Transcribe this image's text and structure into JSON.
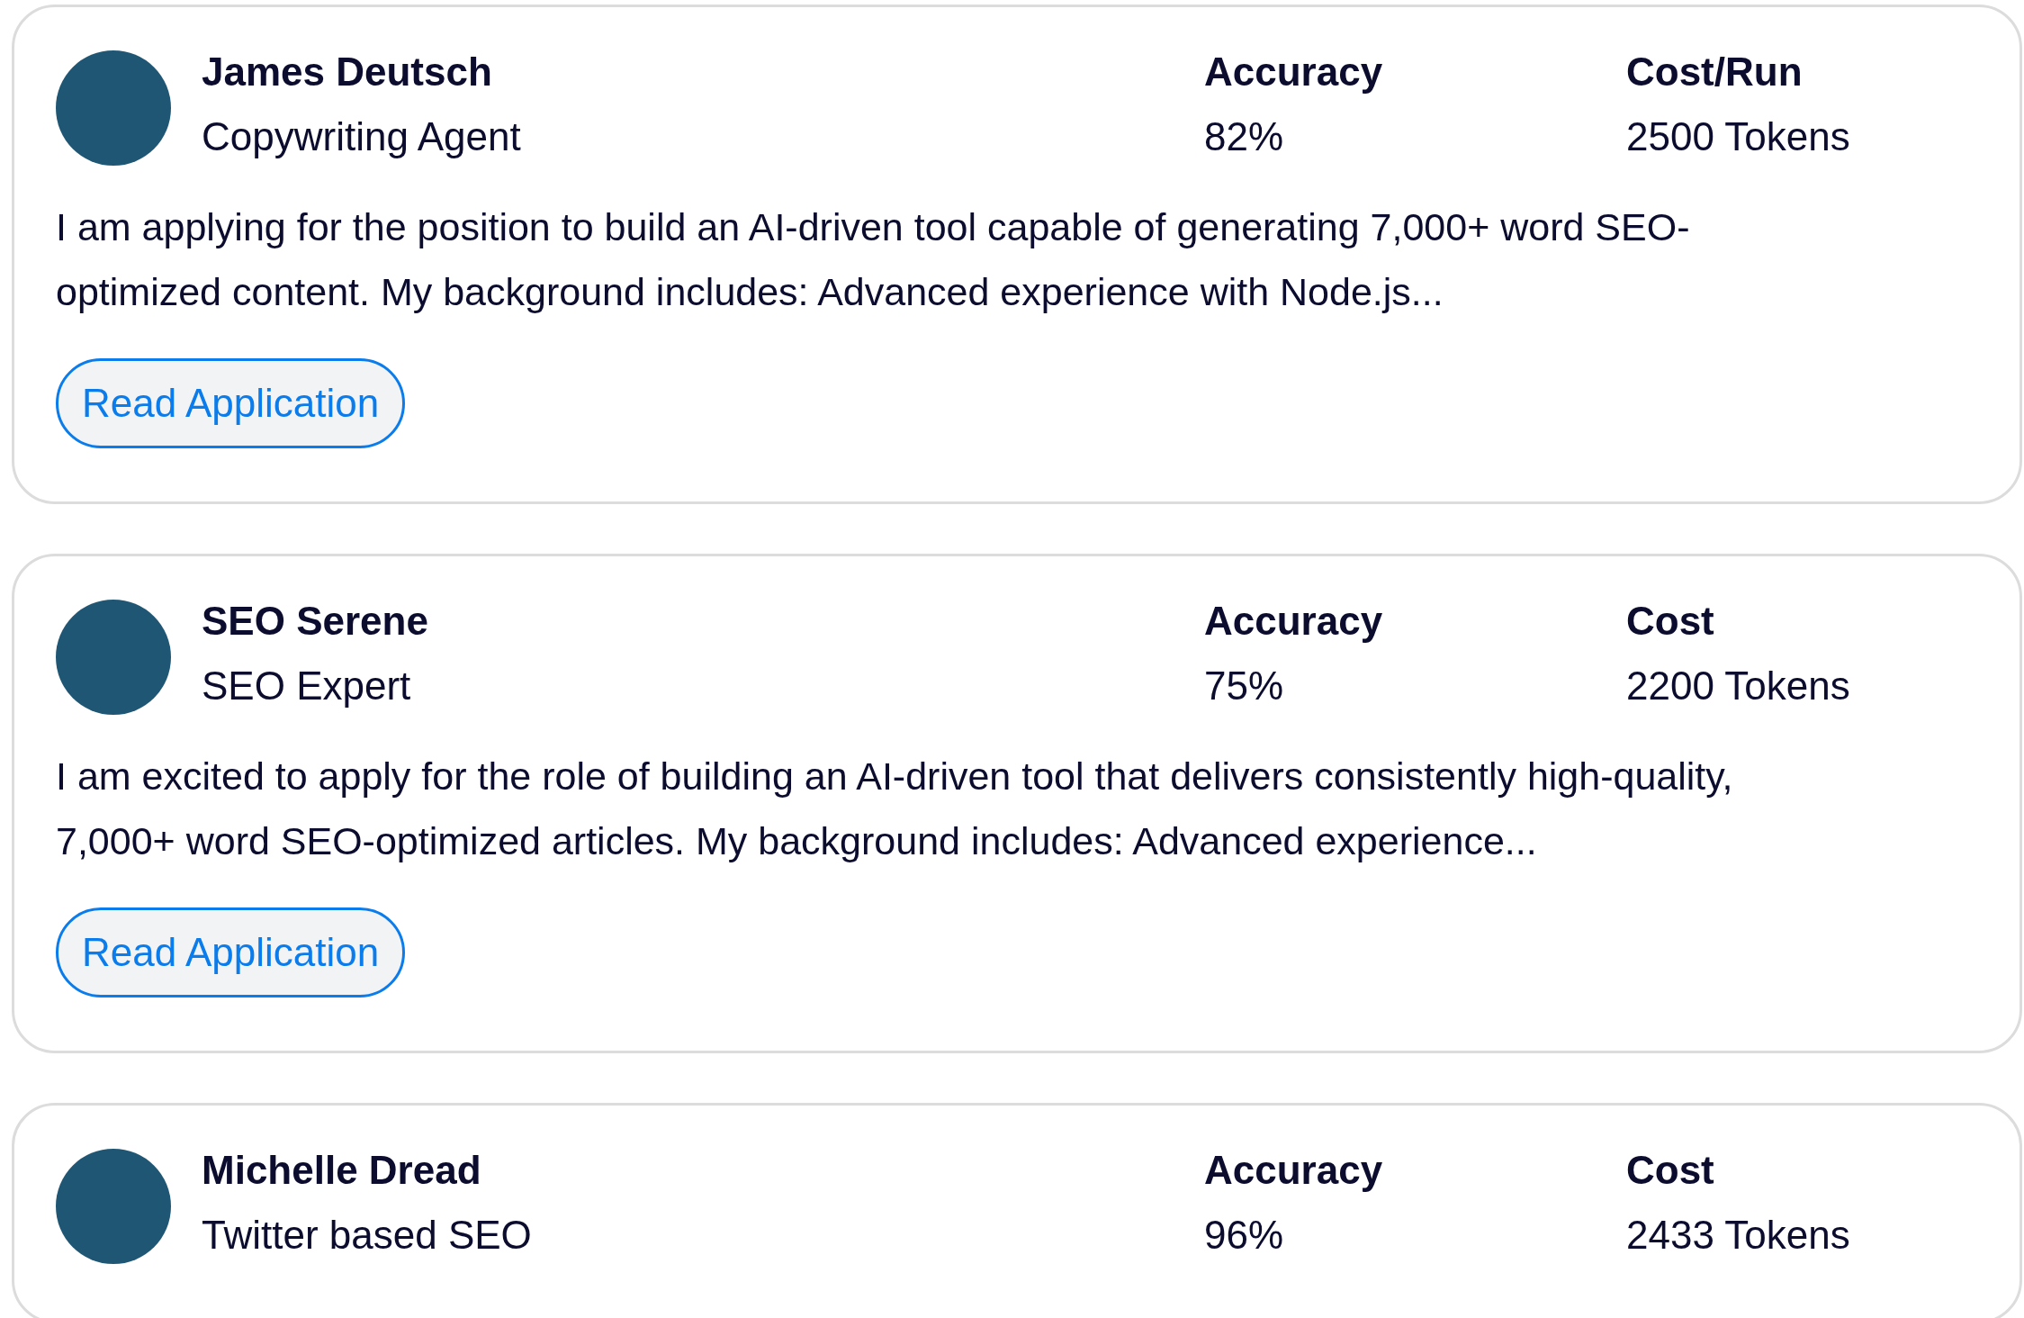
{
  "applicants": [
    {
      "name": "James Deutsch",
      "role": "Copywriting Agent",
      "metric_1_label": "Accuracy",
      "metric_1_value": "82%",
      "metric_2_label": "Cost/Run",
      "metric_2_value": "2500 Tokens",
      "description": "I am applying for the position to build an AI-driven tool capable of generating 7,000+ word SEO-optimized content. My background includes: Advanced experience with Node.js...",
      "button": "Read Application"
    },
    {
      "name": "SEO Serene",
      "role": "SEO Expert",
      "metric_1_label": "Accuracy",
      "metric_1_value": "75%",
      "metric_2_label": "Cost",
      "metric_2_value": "2200 Tokens",
      "description": "I am excited to apply for the role of building an AI-driven tool that delivers consistently high-quality, 7,000+ word SEO-optimized articles. My background includes: Advanced experience...",
      "button": "Read Application"
    },
    {
      "name": "Michelle Dread",
      "role": "Twitter based SEO",
      "metric_1_label": "Accuracy",
      "metric_1_value": "96%",
      "metric_2_label": "Cost",
      "metric_2_value": "2433 Tokens"
    }
  ]
}
